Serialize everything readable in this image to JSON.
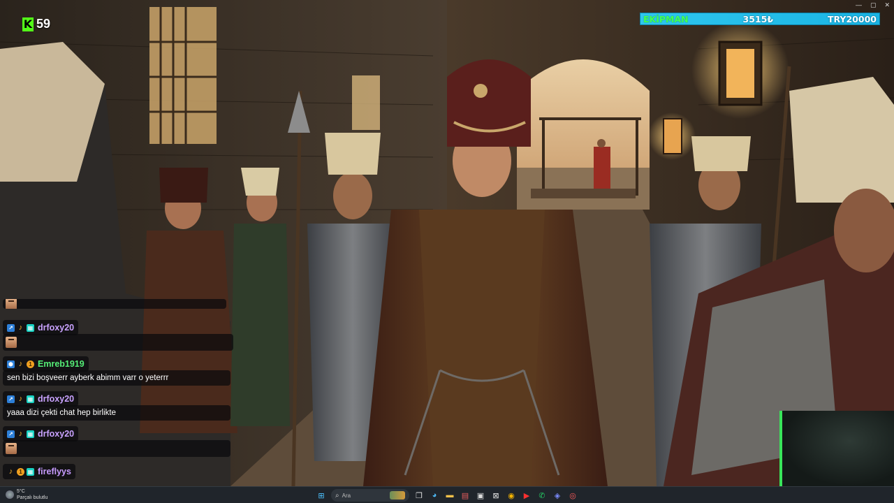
{
  "app": {
    "live_count_badge": "K",
    "viewer_count": "59"
  },
  "equipment_bar": {
    "label": "EKİPMAN",
    "value": "3515₺",
    "goal": "TRY20000",
    "colors": {
      "bar": "#2fc6ee",
      "label": "#43ff5a"
    }
  },
  "chat": {
    "messages": [
      {
        "type": "user",
        "username": "drfoxy20",
        "color": "#c9a2ff"
      },
      {
        "type": "emote"
      },
      {
        "type": "user",
        "username": "Emreb1919",
        "color": "#55ee77"
      },
      {
        "type": "text",
        "text": "sen bizi boşveerr ayberk abimm varr o yeterrr"
      },
      {
        "type": "user",
        "username": "drfoxy20",
        "color": "#c9a2ff"
      },
      {
        "type": "text",
        "text": "yaaa dizi çekti chat hep birlikte"
      },
      {
        "type": "user",
        "username": "drfoxy20",
        "color": "#c9a2ff"
      },
      {
        "type": "emote"
      },
      {
        "type": "user",
        "username": "fireflyys",
        "color": "#c79bff"
      }
    ]
  },
  "taskbar": {
    "weather_temp": "5°C",
    "weather_desc": "Parçalı bulutlu",
    "search_placeholder": "Ara"
  }
}
